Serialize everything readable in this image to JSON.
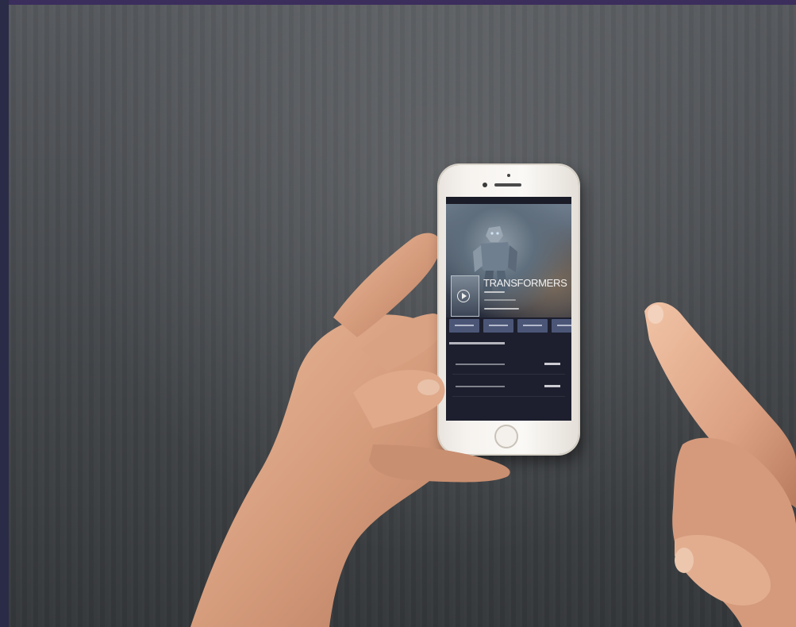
{
  "scene": {
    "background_colors": {
      "wall": "#4a4d51",
      "frame_top": "#3b2d5c",
      "frame_left": "#2a2b46",
      "skin": "#d8a486"
    }
  },
  "phone": {
    "model_color": "#f6f3ef",
    "app": {
      "movie_title": "TRANSFORMERS",
      "play_icon": "play-circle-icon",
      "tab_count": 4,
      "nearby_theater_rows": 2,
      "accent_color": "#4b5677"
    }
  }
}
